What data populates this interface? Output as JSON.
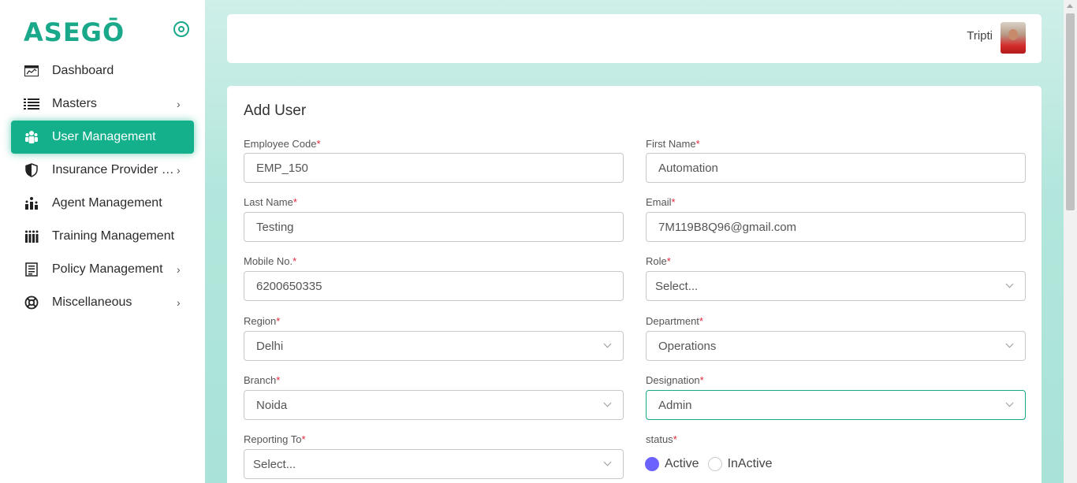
{
  "app": {
    "logo_text": "ASEGŌ"
  },
  "sidebar": {
    "items": [
      {
        "label": "Dashboard",
        "icon": "dashboard-icon",
        "has_chevron": false
      },
      {
        "label": "Masters",
        "icon": "list-icon",
        "has_chevron": true
      },
      {
        "label": "User Management",
        "icon": "users-icon",
        "has_chevron": false,
        "active": true
      },
      {
        "label": "Insurance Provider Management",
        "icon": "shield-icon",
        "has_chevron": true
      },
      {
        "label": "Agent Management",
        "icon": "agent-icon",
        "has_chevron": false
      },
      {
        "label": "Training Management",
        "icon": "training-icon",
        "has_chevron": false
      },
      {
        "label": "Policy Management",
        "icon": "policy-icon",
        "has_chevron": true
      },
      {
        "label": "Miscellaneous",
        "icon": "lifebuoy-icon",
        "has_chevron": true
      }
    ]
  },
  "header": {
    "user_name": "Tripti"
  },
  "form": {
    "title": "Add User",
    "required_mark": "*",
    "employee_code": {
      "label": "Employee Code",
      "value": "EMP_150"
    },
    "first_name": {
      "label": "First Name",
      "value": "Automation"
    },
    "last_name": {
      "label": "Last Name",
      "value": "Testing"
    },
    "email": {
      "label": "Email",
      "value": "7M119B8Q96@gmail.com"
    },
    "mobile": {
      "label": "Mobile No.",
      "value": "6200650335"
    },
    "role": {
      "label": "Role",
      "value": "Select..."
    },
    "region": {
      "label": "Region",
      "value": "Delhi"
    },
    "department": {
      "label": "Department",
      "value": "Operations"
    },
    "branch": {
      "label": "Branch",
      "value": "Noida"
    },
    "designation": {
      "label": "Designation",
      "value": "Admin"
    },
    "reporting_to": {
      "label": "Reporting To",
      "value": "Select..."
    },
    "status": {
      "label": "status",
      "options": [
        "Active",
        "InActive"
      ],
      "selected": "Active"
    }
  },
  "colors": {
    "accent": "#13b08b",
    "radio_checked": "#6c63ff",
    "required": "#e0263a"
  }
}
